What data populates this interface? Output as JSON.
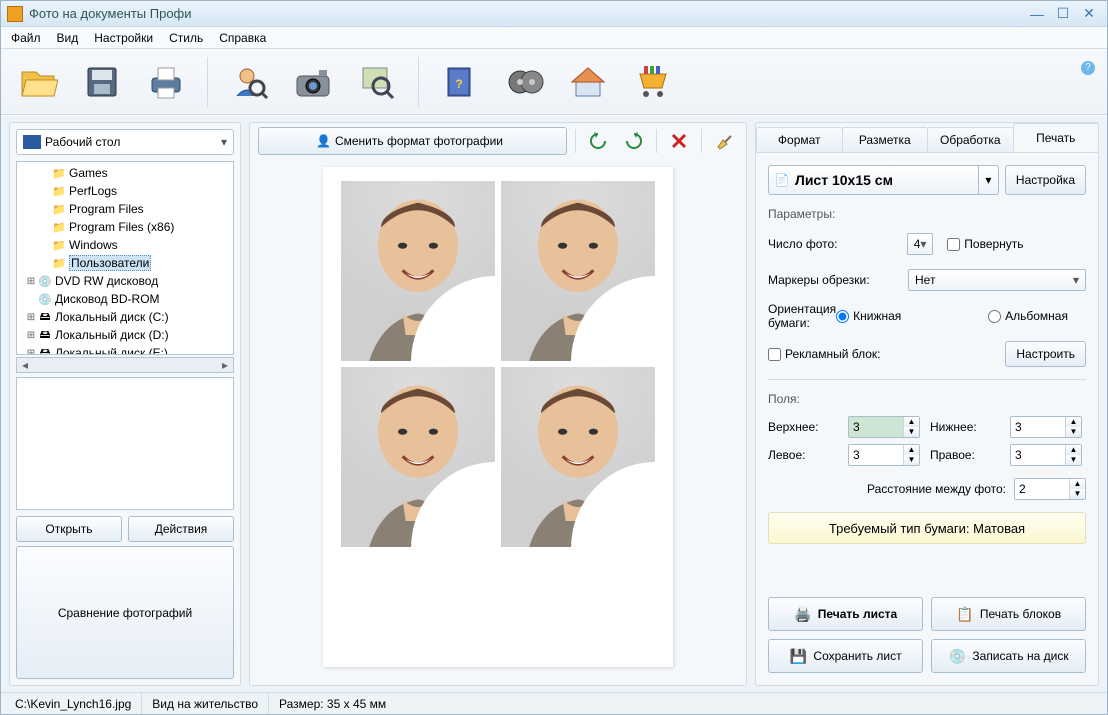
{
  "window": {
    "title": "Фото на документы Профи"
  },
  "menu": [
    "Файл",
    "Вид",
    "Настройки",
    "Стиль",
    "Справка"
  ],
  "left": {
    "root_folder": "Рабочий стол",
    "tree": {
      "folders": [
        "Games",
        "PerfLogs",
        "Program Files",
        "Program Files (x86)",
        "Windows",
        "Пользователи"
      ],
      "drives": [
        "DVD RW дисковод",
        "Дисковод BD-ROM",
        "Локальный диск (C:)",
        "Локальный диск (D:)",
        "Локальный диск (E:)"
      ]
    },
    "open": "Открыть",
    "actions": "Действия",
    "compare": "Сравнение фотографий"
  },
  "center": {
    "change_format": "Сменить формат фотографии"
  },
  "right": {
    "tabs": [
      "Формат",
      "Разметка",
      "Обработка",
      "Печать"
    ],
    "active_tab": 3,
    "sheet": "Лист 10x15 см",
    "settings_btn": "Настройка",
    "params_label": "Параметры:",
    "num_photos_label": "Число фото:",
    "num_photos": "4",
    "rotate": "Повернуть",
    "crop_markers_label": "Маркеры обрезки:",
    "crop_markers": "Нет",
    "orientation_label": "Ориентация бумаги:",
    "orientation_portrait": "Книжная",
    "orientation_landscape": "Альбомная",
    "ad_block": "Рекламный блок:",
    "configure": "Настроить",
    "margins_label": "Поля:",
    "margin_top": "Верхнее:",
    "margin_bottom": "Нижнее:",
    "margin_left": "Левое:",
    "margin_right": "Правое:",
    "margin_top_val": "3",
    "margin_bottom_val": "3",
    "margin_left_val": "3",
    "margin_right_val": "3",
    "spacing_label": "Расстояние между фото:",
    "spacing": "2",
    "paper_banner": "Требуемый тип бумаги: Матовая",
    "print_sheet": "Печать листа",
    "print_blocks": "Печать блоков",
    "save_sheet": "Сохранить лист",
    "burn_disc": "Записать на диск"
  },
  "status": {
    "file": "C:\\Kevin_Lynch16.jpg",
    "doc_type": "Вид на жительство",
    "size": "Размер: 35 x 45 мм"
  }
}
